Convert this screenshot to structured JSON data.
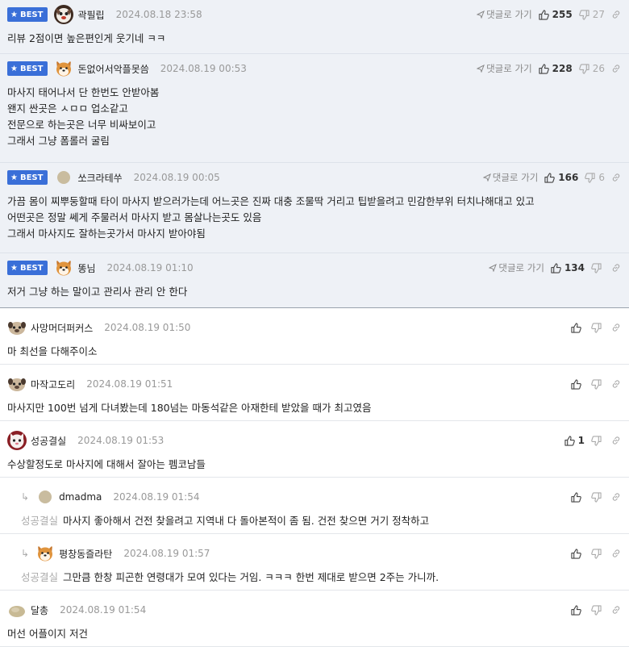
{
  "ui": {
    "reply_label": "댓글로 가기",
    "best_label": "BEST"
  },
  "comments": [
    {
      "best": true,
      "nick": "곽필립",
      "date": "2024.08.18 23:58",
      "up": "255",
      "down": "27",
      "lines": [
        "리뷰 2점이면 높은편인게 웃기네 ㅋㅋ"
      ]
    },
    {
      "best": true,
      "nick": "돈없어서악플못씀",
      "date": "2024.08.19 00:53",
      "up": "228",
      "down": "26",
      "lines": [
        "마사지 태어나서 단 한번도 안받아봄",
        "왠지 싼곳은 ㅅㅁㅁ 업소같고",
        "전문으로 하는곳은 너무 비싸보이고",
        "그래서 그냥 폼롤러 굴림"
      ]
    },
    {
      "best": true,
      "nick": "쏘크라테쑤",
      "date": "2024.08.19 00:05",
      "up": "166",
      "down": "6",
      "lines": [
        "가끔 몸이 찌뿌둥할때 타이 마사지 받으러가는데 어느곳은 진짜 대충 조물딱 거리고 팁받을려고 민감한부위 터치나해대고 있고",
        "어떤곳은 정말 쎄게 주물러서 마사지 받고 몸살나는곳도 있음",
        "그래서 마사지도 잘하는곳가서 마사지 받아야됨"
      ]
    },
    {
      "best": true,
      "nick": "똥님",
      "date": "2024.08.19 01:10",
      "up": "134",
      "down": "",
      "lines": [
        "저거 그냥 하는 말이고 관리사 관리 안 한다"
      ]
    },
    {
      "nick": "사망머더퍼커스",
      "date": "2024.08.19 01:50",
      "up": "",
      "down": "",
      "lines": [
        "마 최선을 다해주이소"
      ]
    },
    {
      "nick": "마작고도리",
      "date": "2024.08.19 01:51",
      "up": "",
      "down": "",
      "lines": [
        "마사지만 100번 넘게 다녀봤는데 180넘는 마동석같은 아재한테 받았을 때가 최고였음"
      ]
    },
    {
      "nick": "성공결실",
      "date": "2024.08.19 01:53",
      "up": "1",
      "down": "",
      "lines": [
        "수상할정도로 마사지에 대해서 잘아는 펨코남들"
      ]
    },
    {
      "reply": true,
      "nick": "dmadma",
      "date": "2024.08.19 01:54",
      "up": "",
      "down": "",
      "mention": "성공결실",
      "lines": [
        "마사지 좋아해서 건전 찾을려고 지역내 다 돌아본적이 좀 됨. 건전 찾으면 거기 정착하고"
      ]
    },
    {
      "reply": true,
      "nick": "평창동즐라탄",
      "date": "2024.08.19 01:57",
      "up": "",
      "down": "",
      "mention": "성공결실",
      "lines": [
        "그만큼 한창 피곤한 연령대가 모여 있다는 거임. ㅋㅋㅋ 한번 제대로 받으면 2주는 가니까."
      ]
    },
    {
      "nick": "달총",
      "date": "2024.08.19 01:54",
      "up": "",
      "down": "",
      "lines": [
        "머선 어플이지 저건"
      ]
    }
  ]
}
